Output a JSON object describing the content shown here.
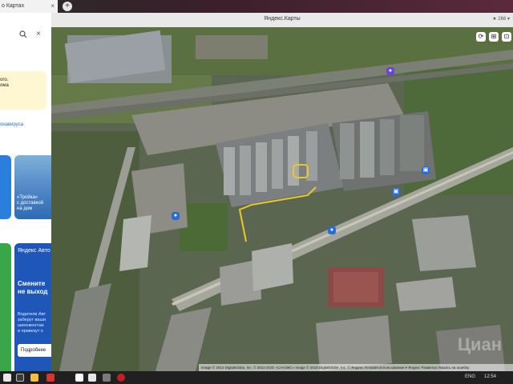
{
  "browser": {
    "tab_title": "о Картах",
    "tab_close": "×",
    "new_tab": "+",
    "window_title": "Яндекс.Карты",
    "rating": "★ 266 ▾"
  },
  "left_panel": {
    "clear_icon": "×",
    "notice_text": "ого.\nома",
    "virus_link": "онавирусa",
    "promo_troika": "«Тройка»\nс доставкой\nна дом",
    "promo_auto_brand": "Яндекс Авто",
    "promo_auto_headline": "Смените\nне выход",
    "promo_auto_body": "Водители Авт\nзаберут ваши\nшиномонтаж\nи привезут о",
    "promo_auto_button": "Подробнее"
  },
  "map": {
    "attribution": "Image © 2012 DigitalGlobe, Inc. © 2013 ООО «САНЭКС» Image © 2018 DigitalGlobe, Inc. © Яндекс  Условия использования  ▾ Яндекс  Разметка  Указать на ошибку",
    "watermark": "Циан",
    "controls": [
      "⟳",
      "⊞",
      "⊡"
    ]
  },
  "taskbar": {
    "time": "12:54",
    "lang": "ENG"
  },
  "colors": {
    "route": "#e9c82b",
    "poi_blue": "#2a6cd6",
    "poi_purple": "#6a45d6"
  }
}
